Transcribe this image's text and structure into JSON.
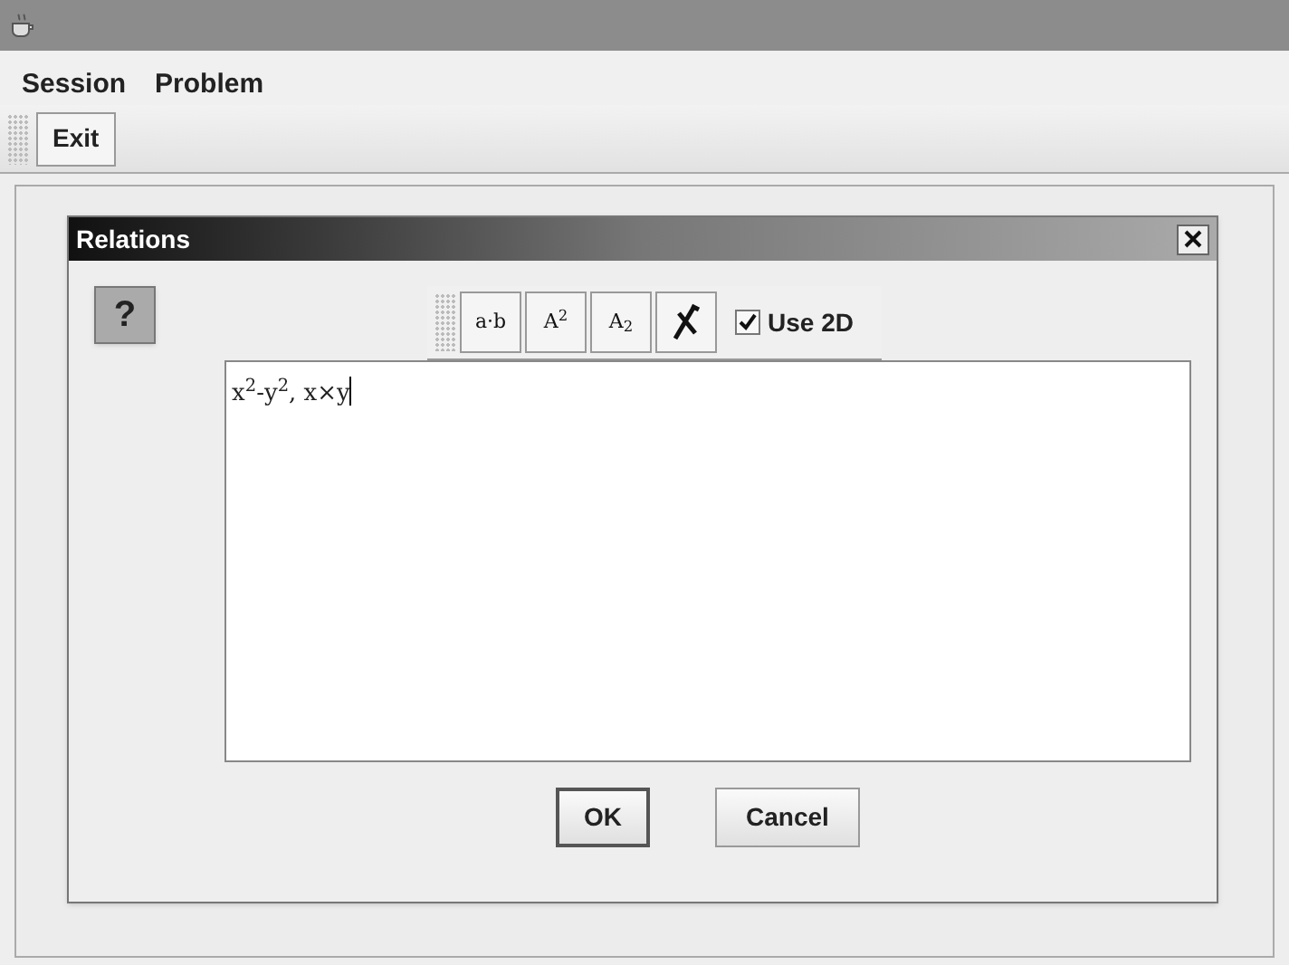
{
  "menu": [
    {
      "label": "Session"
    },
    {
      "label": "Problem"
    }
  ],
  "toolbar": {
    "buttons": [
      "Exit"
    ]
  },
  "dialog": {
    "title": "Relations",
    "help_button": "?",
    "format_buttons": [
      {
        "kind": "text",
        "label": "a·b"
      },
      {
        "kind": "text",
        "label": "A$^{2}$"
      },
      {
        "kind": "text",
        "label": "A$_{2}$"
      },
      {
        "kind": "icon"
      }
    ],
    "use_2d": {
      "label": "Use 2D",
      "checked": true
    },
    "input": {
      "value": "x$^{2}$-y$^{2}$, x×y"
    },
    "buttons": [
      "OK",
      "Cancel"
    ]
  }
}
